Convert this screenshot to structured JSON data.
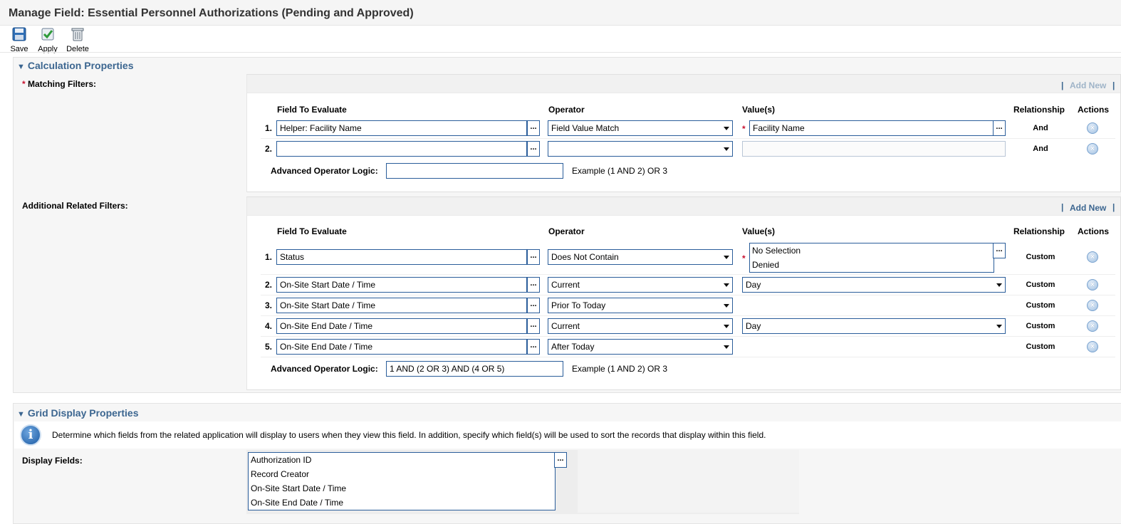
{
  "title": "Manage Field: Essential Personnel Authorizations (Pending and Approved)",
  "toolbar": {
    "save_label": "Save",
    "apply_label": "Apply",
    "delete_label": "Delete"
  },
  "calc": {
    "heading": "Calculation Properties",
    "matching": {
      "label": "Matching Filters:",
      "required_mark": "*",
      "add_new": "Add New",
      "pipe": "|",
      "headers": {
        "field": "Field To Evaluate",
        "operator": "Operator",
        "values": "Value(s)",
        "relationship": "Relationship",
        "actions": "Actions"
      },
      "rows": [
        {
          "num": "1.",
          "field": "Helper: Facility Name",
          "operator": "Field Value Match",
          "value": "Facility Name",
          "relationship": "And"
        },
        {
          "num": "2.",
          "field": "",
          "operator": "",
          "value": "",
          "relationship": "And"
        }
      ],
      "logic_label": "Advanced Operator Logic:",
      "logic_value": "",
      "example": "Example (1 AND 2) OR 3"
    },
    "additional": {
      "label": "Additional Related Filters:",
      "add_new": "Add New",
      "pipe": "|",
      "headers": {
        "field": "Field To Evaluate",
        "operator": "Operator",
        "values": "Value(s)",
        "relationship": "Relationship",
        "actions": "Actions"
      },
      "rows": [
        {
          "num": "1.",
          "field": "Status",
          "operator": "Does Not Contain",
          "value_list": [
            "No Selection",
            "Denied"
          ],
          "relationship": "Custom"
        },
        {
          "num": "2.",
          "field": "On-Site Start Date / Time",
          "operator": "Current",
          "value": "Day",
          "relationship": "Custom"
        },
        {
          "num": "3.",
          "field": "On-Site Start Date / Time",
          "operator": "Prior To Today",
          "value": "",
          "relationship": "Custom"
        },
        {
          "num": "4.",
          "field": "On-Site End Date / Time",
          "operator": "Current",
          "value": "Day",
          "relationship": "Custom"
        },
        {
          "num": "5.",
          "field": "On-Site End Date / Time",
          "operator": "After Today",
          "value": "",
          "relationship": "Custom"
        }
      ],
      "logic_label": "Advanced Operator Logic:",
      "logic_value": "1 AND (2 OR 3) AND (4 OR 5)",
      "example": "Example (1 AND 2) OR 3"
    }
  },
  "grid": {
    "heading": "Grid Display Properties",
    "info": "Determine which fields from the related application will display to users when they view this field. In addition, specify which field(s) will be used to sort the records that display within this field.",
    "display_label": "Display Fields:",
    "display_fields": [
      "Authorization ID",
      "Record Creator",
      "On-Site Start Date / Time",
      "On-Site End Date / Time"
    ]
  },
  "icons": {
    "save": "save-disk-icon",
    "apply": "apply-icon",
    "delete": "trash-icon",
    "remove": "remove-circle-icon",
    "info": "info-icon",
    "dots": "ellipsis"
  },
  "colors": {
    "accent": "#3c6690",
    "required": "#c8102e",
    "input_border": "#2a5d9a"
  }
}
